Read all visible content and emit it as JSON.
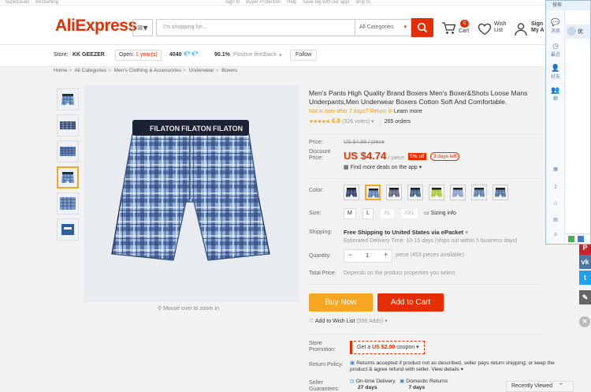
{
  "topstrip": [
    "SuperDeals",
    "Bestselling",
    "Sign In",
    "Buyer Protection",
    "Help",
    "Save big with our app!",
    "Ship to"
  ],
  "header": {
    "logo": "AliExpress",
    "search_placeholder": "I'm shopping for...",
    "category_select": "All Categories",
    "cart_label": "Cart",
    "cart_count": "0",
    "wishlist_label": "Wish\nList",
    "account_label": "Sign\nMy A"
  },
  "store": {
    "store_label": "Store:",
    "store_name": "KK GEEZER",
    "open_label": "Open:",
    "open_value": "1 year(s)",
    "score": "4040",
    "feedback_pct": "90.1%",
    "feedback_label": "Positive feedback",
    "follow_label": "Follow"
  },
  "breadcrumbs": [
    "Home",
    "All Categories",
    "Men's Clothing & Accessories",
    "Underwear",
    "Boxers"
  ],
  "gallery": {
    "zoom_hint": "Mouse over to zoom in",
    "waistband_text": "FILATON"
  },
  "product": {
    "title": "Men's Pants High Quality Brand Boxers Men's Boxer&Shots Loose Mans Underpants,Men Underwear Boxers Cotton Soft And Comfortable.",
    "promo_text": "Not in love after 7 days? Return it!",
    "promo_link": "Learn more",
    "rating": "4.8",
    "votes": "(326 votes)",
    "orders": "265 orders",
    "price_label": "Price:",
    "old_price": "US $4.99 / piece",
    "discount_label": "Discount Price:",
    "price": "US $4.74",
    "price_unit": "/ piece",
    "off_badge": "5% off",
    "days_left": "3 days left",
    "app_deals": "Find more deals on the app",
    "color_label": "Color:",
    "size_label": "Size:",
    "sizes": [
      {
        "label": "M",
        "available": true
      },
      {
        "label": "L",
        "available": true
      },
      {
        "label": "XL",
        "available": false
      },
      {
        "label": "XXL",
        "available": false
      }
    ],
    "size_info": "Sizing info",
    "shipping_label": "Shipping:",
    "shipping_text": "Free Shipping to United States via ePacket",
    "delivery_text": "Estimated Delivery Time: 10-15 days (ships out within 5 business days)",
    "quantity_label": "Quantity:",
    "quantity": "1",
    "qty_available": "piece (453 pieces available)",
    "total_label": "Total Price:",
    "total_text": "Depends on the product properties you select",
    "buy_now": "Buy Now",
    "add_to_cart": "Add to Cart",
    "wishlist_text": "Add to Wish List",
    "wishlist_count": "(598 Adds)",
    "store_promo_label": "Store Promotion:",
    "coupon_prefix": "Get a",
    "coupon_value": "US $2.00",
    "coupon_suffix": "coupon",
    "return_label": "Return Policy:",
    "return_text": "Returns accepted if product not as described, seller pays return shipping; or keep the product & agree refund with seller.",
    "return_link": "View details",
    "guarantee_label": "Seller Guarantees:",
    "guarantee_1": "On-time Delivery",
    "guarantee_1_days": "27 days",
    "guarantee_2": "Domestic Returns",
    "guarantee_2_days": "7 days"
  },
  "recently_viewed": "Recently Viewed",
  "im_panel": {
    "title": "搜索",
    "tabs": [
      "消息",
      "最近",
      "好友",
      "群"
    ],
    "contact_label": "优"
  },
  "colors": {
    "brand_red": "#e62e04",
    "brand_orange": "#f5a623",
    "swatches": [
      "#2c3e6b",
      "#5b7fb5",
      "#5c6678",
      "#3f5f86",
      "#a8c93a",
      "#8aa0c8",
      "#5d80ad",
      "#4e6fa0"
    ]
  }
}
